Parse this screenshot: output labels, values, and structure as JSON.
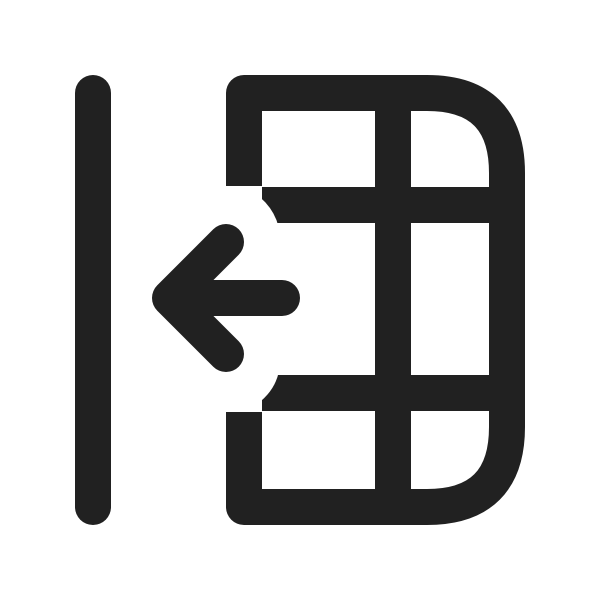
{
  "icon": {
    "name": "table-move-left-icon",
    "stroke_color": "#212121",
    "background_color": "#ffffff"
  }
}
